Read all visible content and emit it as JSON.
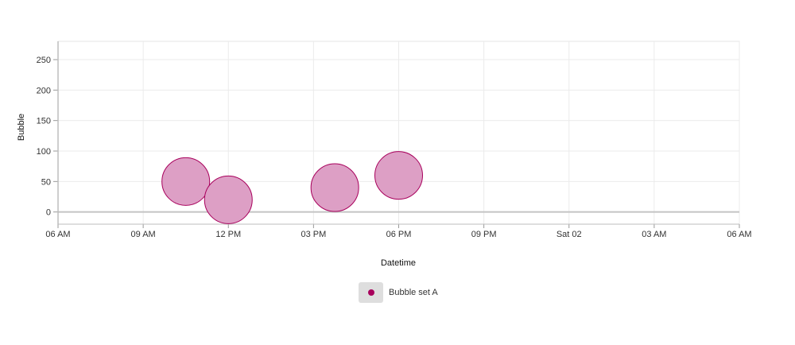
{
  "chart_data": {
    "type": "scatter",
    "subtype": "bubble",
    "xlabel": "Datetime",
    "ylabel": "Bubble",
    "x_ticks": [
      "06 AM",
      "09 AM",
      "12 PM",
      "03 PM",
      "06 PM",
      "09 PM",
      "Sat 02",
      "03 AM",
      "06 AM"
    ],
    "y_ticks": [
      0,
      50,
      100,
      150,
      200,
      250
    ],
    "xlim": [
      "06:00",
      "06:00 (+1 day)"
    ],
    "ylim": [
      -20,
      280
    ],
    "grid": true,
    "legend_position": "bottom-center",
    "series": [
      {
        "name": "Bubble set A",
        "color": "#a8005c",
        "fill": "#dd9fc5",
        "points": [
          {
            "x": "10:30",
            "y": 50,
            "r": 30
          },
          {
            "x": "12:00",
            "y": 20,
            "r": 30
          },
          {
            "x": "15:45",
            "y": 40,
            "r": 30
          },
          {
            "x": "18:00",
            "y": 60,
            "r": 30
          }
        ]
      }
    ]
  }
}
